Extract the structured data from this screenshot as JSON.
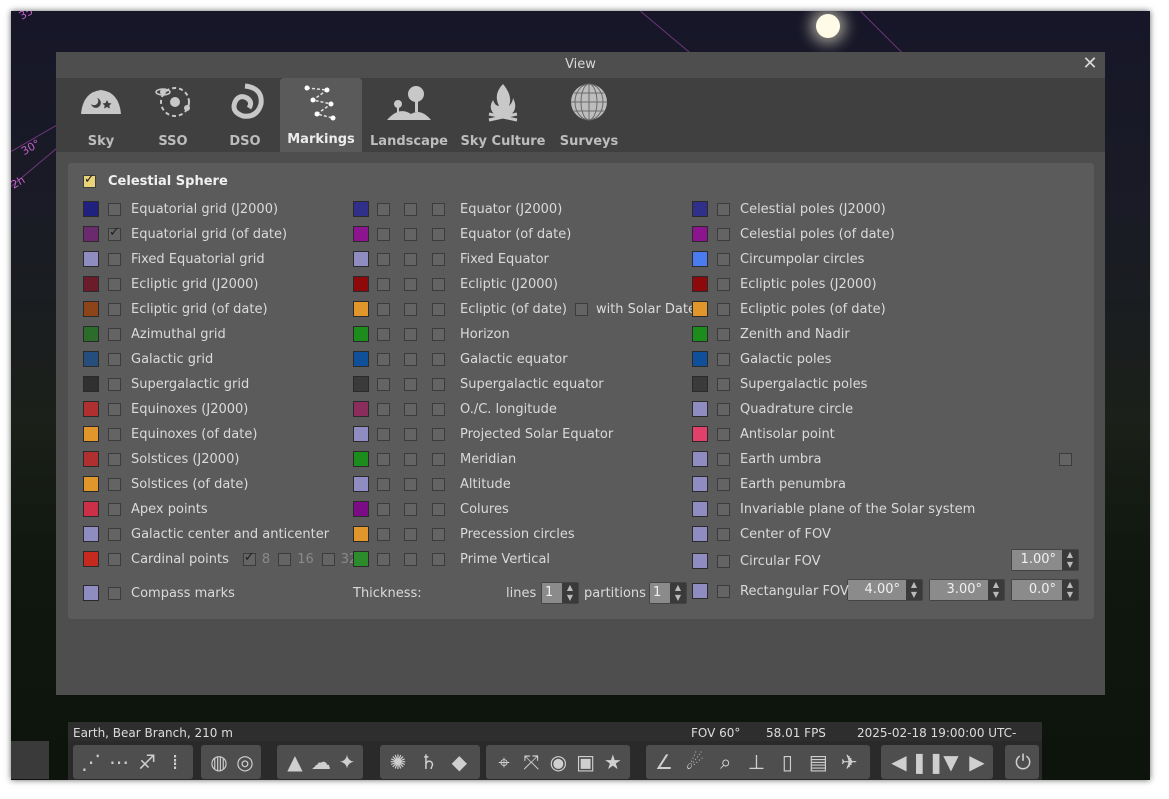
{
  "window_title": "View",
  "close_label": "✕",
  "sky_labels": [
    "30°",
    "2h",
    "35"
  ],
  "tabs": [
    {
      "label": "Sky",
      "icon": "sky-icon"
    },
    {
      "label": "SSO",
      "icon": "planets-icon"
    },
    {
      "label": "DSO",
      "icon": "galaxy-icon"
    },
    {
      "label": "Markings",
      "icon": "constellation-icon",
      "active": true
    },
    {
      "label": "Landscape",
      "icon": "landscape-icon"
    },
    {
      "label": "Sky Culture",
      "icon": "campfire-icon"
    },
    {
      "label": "Surveys",
      "icon": "globe-icon"
    }
  ],
  "section_title": "Celestial Sphere",
  "col1": [
    {
      "label": "Equatorial grid (J2000)",
      "color": "#20207e",
      "checked": false
    },
    {
      "label": "Equatorial grid (of date)",
      "color": "#6c2a6e",
      "checked": true
    },
    {
      "label": "Fixed Equatorial grid",
      "color": "#8e8cc0",
      "checked": false
    },
    {
      "label": "Ecliptic grid (J2000)",
      "color": "#6a1c2a",
      "checked": false
    },
    {
      "label": "Ecliptic grid (of date)",
      "color": "#8c4418",
      "checked": false
    },
    {
      "label": "Azimuthal grid",
      "color": "#2c6c2a",
      "checked": false
    },
    {
      "label": "Galactic grid",
      "color": "#264e7c",
      "checked": false
    },
    {
      "label": "Supergalactic grid",
      "color": "#303030",
      "checked": false
    },
    {
      "label": "Equinoxes (J2000)",
      "color": "#b03030",
      "checked": false
    },
    {
      "label": "Equinoxes (of date)",
      "color": "#e0962a",
      "checked": false
    },
    {
      "label": "Solstices (J2000)",
      "color": "#b03030",
      "checked": false
    },
    {
      "label": "Solstices (of date)",
      "color": "#e0962a",
      "checked": false
    },
    {
      "label": "Apex points",
      "color": "#cc3048",
      "checked": false
    },
    {
      "label": "Galactic center and anticenter",
      "color": "#8e8cc0",
      "checked": false
    },
    {
      "label": "Cardinal points",
      "color": "#c62a1e",
      "checked": false
    }
  ],
  "cardinal_options": [
    {
      "label": "8",
      "checked": true
    },
    {
      "label": "16",
      "checked": false
    },
    {
      "label": "32",
      "checked": false
    }
  ],
  "compass": {
    "label": "Compass marks",
    "color": "#8e8cc0"
  },
  "col2": [
    {
      "label": "Equator (J2000)",
      "color": "#30308a"
    },
    {
      "label": "Equator (of date)",
      "color": "#8c148e"
    },
    {
      "label": "Fixed Equator",
      "color": "#8e8cc0"
    },
    {
      "label": "Ecliptic (J2000)",
      "color": "#8e0a0a"
    },
    {
      "label": "Ecliptic (of date)",
      "color": "#e0962a"
    },
    {
      "label": "Horizon",
      "color": "#1c8c1c"
    },
    {
      "label": "Galactic equator",
      "color": "#10509a"
    },
    {
      "label": "Supergalactic equator",
      "color": "#3a3a3a"
    },
    {
      "label": "O./C. longitude",
      "color": "#8a2c5c"
    },
    {
      "label": "Projected Solar Equator",
      "color": "#8e8cc0"
    },
    {
      "label": "Meridian",
      "color": "#1c8c1c"
    },
    {
      "label": "Altitude",
      "color": "#8e8cc0"
    },
    {
      "label": "Colures",
      "color": "#7c0c86"
    },
    {
      "label": "Precession circles",
      "color": "#e0962a"
    },
    {
      "label": "Prime Vertical",
      "color": "#2c8c2c"
    }
  ],
  "solar_dates_label": "with Solar Dates",
  "thickness": {
    "label": "Thickness:",
    "lines_label": "lines",
    "lines_value": "1",
    "partitions_label": "partitions",
    "partitions_value": "1"
  },
  "col3": [
    {
      "label": "Celestial poles (J2000)",
      "color": "#30308a"
    },
    {
      "label": "Celestial poles (of date)",
      "color": "#8c148e"
    },
    {
      "label": "Circumpolar circles",
      "color": "#4a7cf0"
    },
    {
      "label": "Ecliptic poles (J2000)",
      "color": "#8e0a0a"
    },
    {
      "label": "Ecliptic poles (of date)",
      "color": "#e0962a"
    },
    {
      "label": "Zenith and Nadir",
      "color": "#1c8c1c"
    },
    {
      "label": "Galactic poles",
      "color": "#10509a"
    },
    {
      "label": "Supergalactic poles",
      "color": "#3a3a3a"
    },
    {
      "label": "Quadrature circle",
      "color": "#8e8cc0"
    },
    {
      "label": "Antisolar point",
      "color": "#e0406a"
    },
    {
      "label": "Earth umbra",
      "color": "#8e8cc0"
    },
    {
      "label": "Earth penumbra",
      "color": "#8e8cc0"
    },
    {
      "label": "Invariable plane of the Solar system",
      "color": "#8e8cc0"
    },
    {
      "label": "Center of FOV",
      "color": "#8e8cc0"
    },
    {
      "label": "Circular FOV",
      "color": "#8e8cc0"
    },
    {
      "label": "Rectangular FOV",
      "color": "#8e8cc0"
    }
  ],
  "circular_fov_value": "1.00°",
  "rect_fov_values": [
    "4.00°",
    "3.00°",
    "0.0°"
  ],
  "status": {
    "location": "Earth, Bear Branch, 210 m",
    "fov": "FOV 60°",
    "fps": "58.01 FPS",
    "datetime": "2025-02-18 19:00:00 UTC-05:00"
  },
  "toolbar_icons": [
    "constellation-lines-icon",
    "constellation-labels-icon",
    "constellation-art-icon",
    "asterism-icon",
    "equatorial-grid-icon",
    "azimuthal-grid-icon",
    "ground-icon",
    "atmosphere-icon",
    "cardinal-points-icon",
    "nebulae-icon",
    "planets-icon",
    "satellites-icon",
    "telescope-icon",
    "fullscreen-icon",
    "night-mode-icon",
    "screenshot-icon",
    "bookmark-icon",
    "measure-icon",
    "meteor-icon",
    "search-icon",
    "ocular-icon",
    "trash-icon",
    "script-icon",
    "satellite-icon",
    "rewind-icon",
    "pause-icon",
    "set-time-icon",
    "fast-forward-icon",
    "quit-icon"
  ]
}
